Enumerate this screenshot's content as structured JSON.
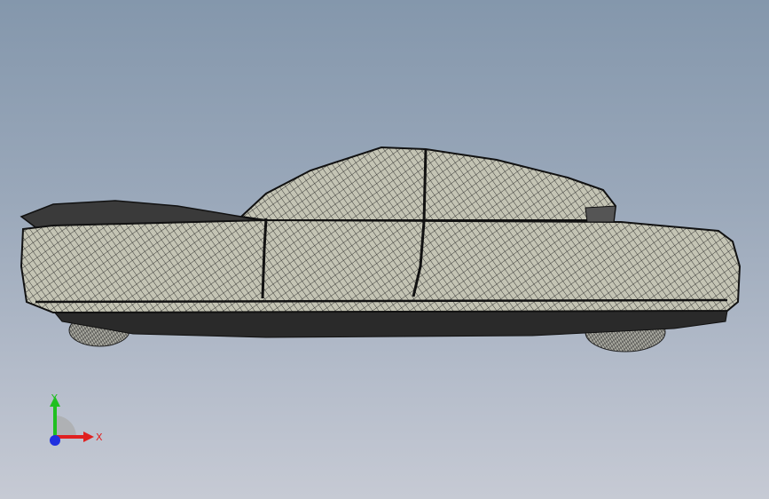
{
  "viewport": {
    "background_top": "#8497ac",
    "background_bottom": "#c6cad4",
    "model": {
      "kind": "car-mesh-wireframe",
      "view": "side",
      "fill_color": "#c4c4b4",
      "edge_color": "#111111"
    }
  },
  "triad": {
    "x_label": "X",
    "y_label": "Y",
    "x_color": "#e02020",
    "y_color": "#20c020",
    "z_color": "#2030e0"
  }
}
